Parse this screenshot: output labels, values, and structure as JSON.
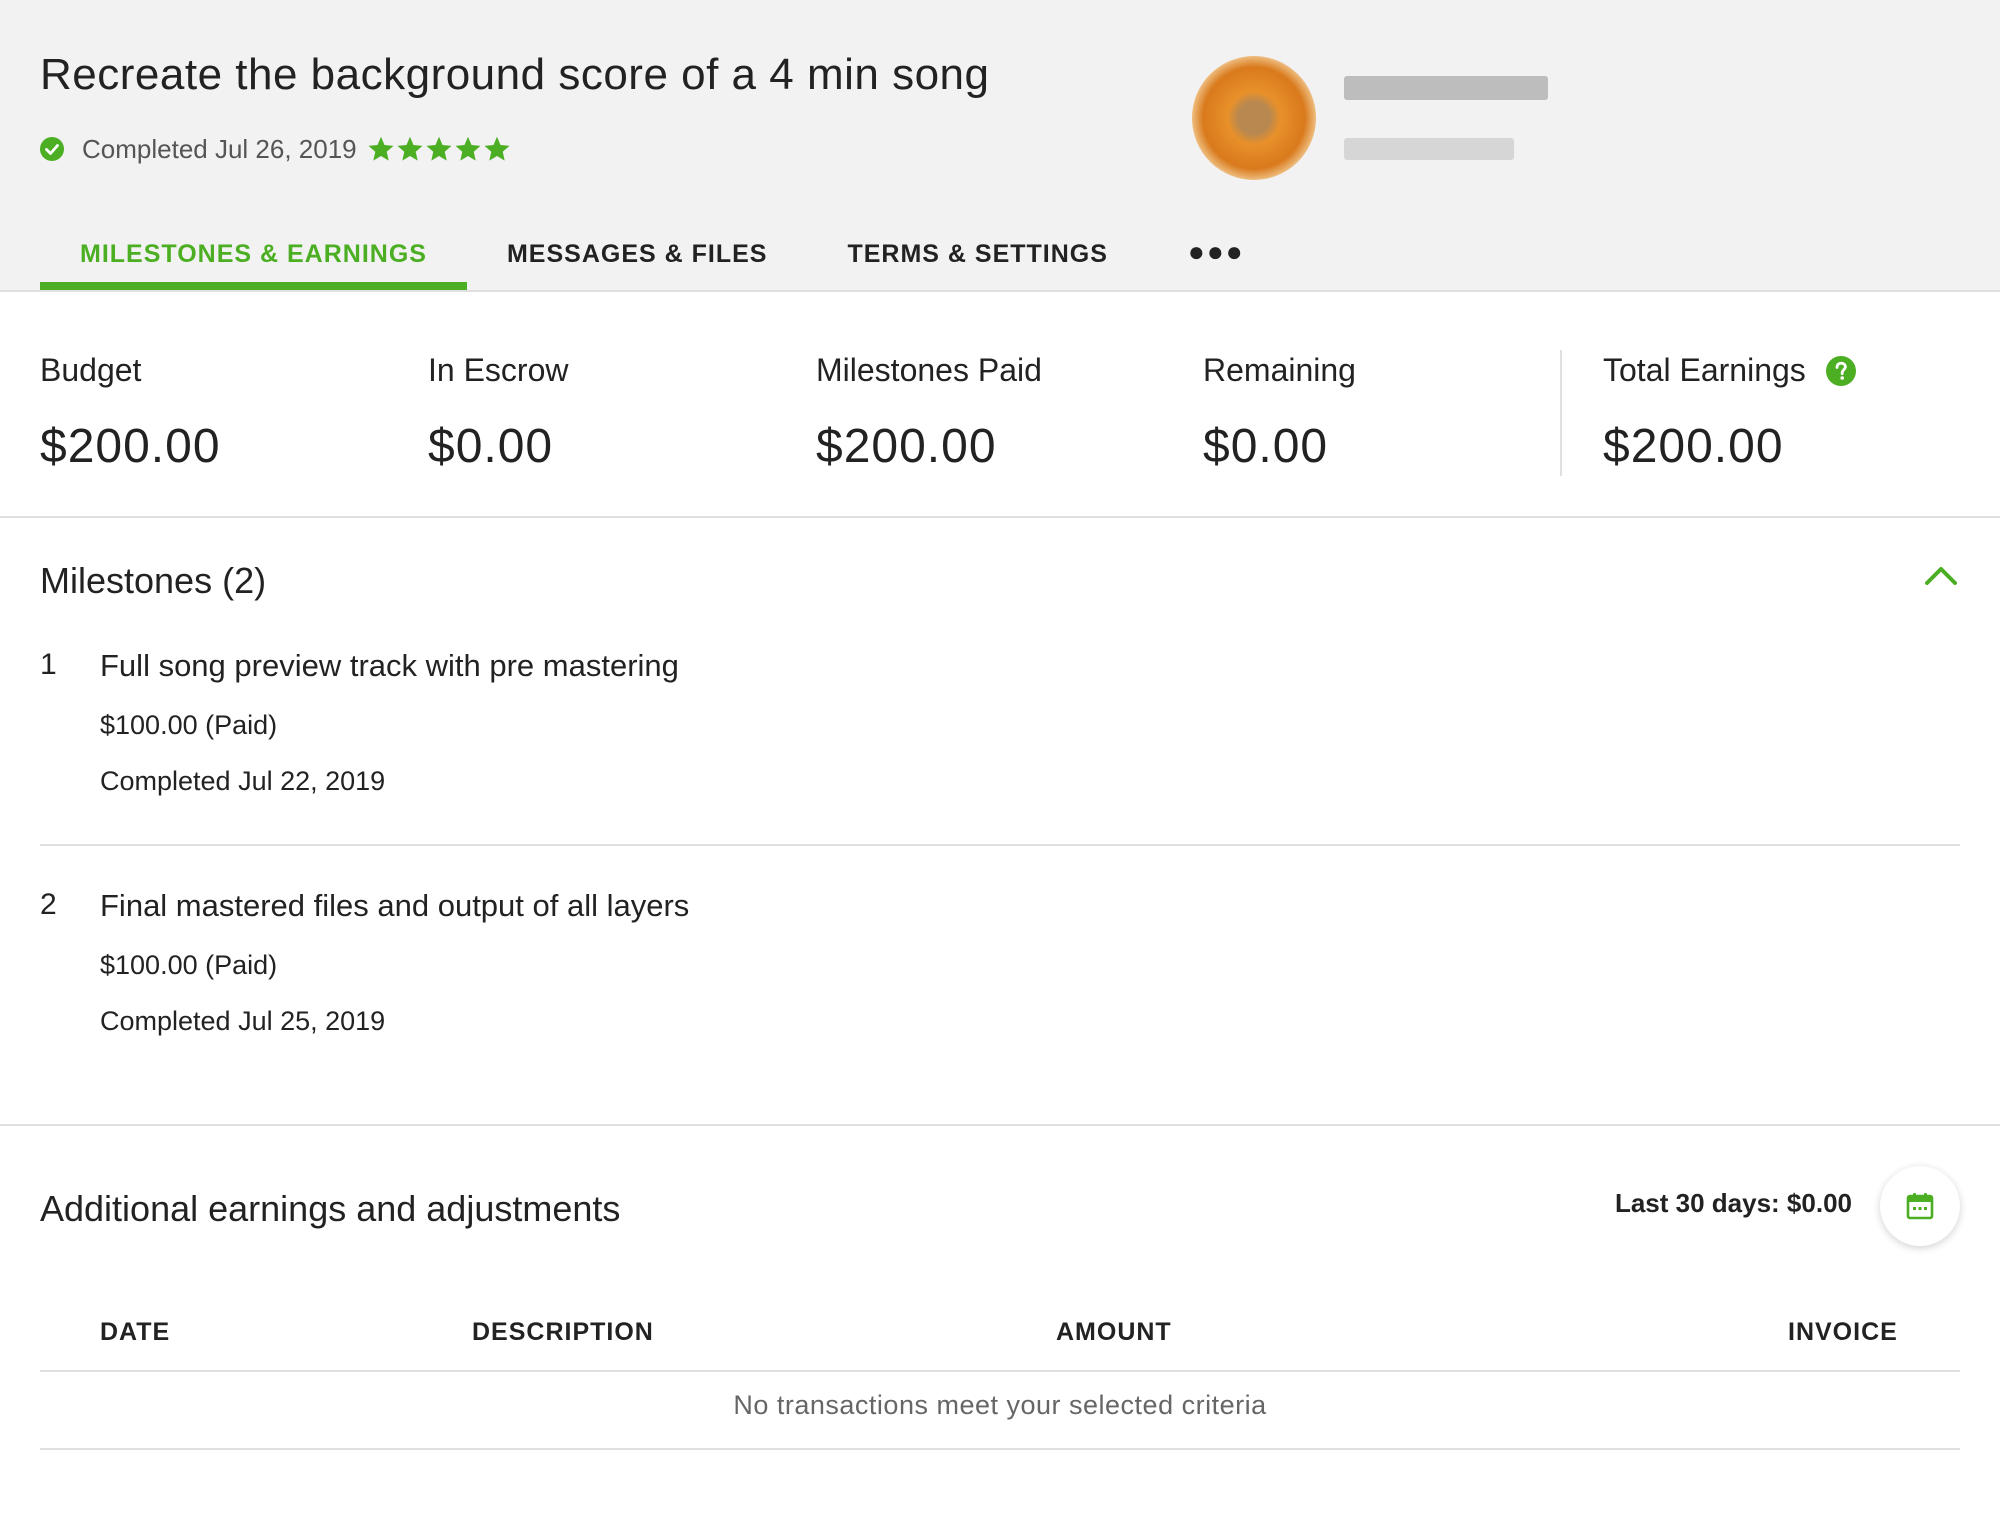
{
  "job": {
    "title": "Recreate the background score of a 4 min song",
    "status": "Completed Jul 26, 2019",
    "rating_stars": 5
  },
  "tabs": [
    {
      "label": "MILESTONES & EARNINGS",
      "active": true
    },
    {
      "label": "MESSAGES & FILES",
      "active": false
    },
    {
      "label": "TERMS & SETTINGS",
      "active": false
    }
  ],
  "tabs_more": "●●●",
  "summary": {
    "budget_label": "Budget",
    "budget_value": "$200.00",
    "escrow_label": "In Escrow",
    "escrow_value": "$0.00",
    "paid_label": "Milestones Paid",
    "paid_value": "$200.00",
    "remaining_label": "Remaining",
    "remaining_value": "$0.00",
    "total_label": "Total Earnings",
    "total_value": "$200.00"
  },
  "milestones": {
    "title": "Milestones (2)",
    "items": [
      {
        "num": "1",
        "title": "Full song preview track with pre mastering",
        "amount": "$100.00 (Paid)",
        "date": "Completed Jul 22, 2019"
      },
      {
        "num": "2",
        "title": "Final mastered files and output of all layers",
        "amount": "$100.00 (Paid)",
        "date": "Completed Jul 25, 2019"
      }
    ]
  },
  "adjustments": {
    "title": "Additional earnings and adjustments",
    "last30": "Last 30 days: $0.00",
    "columns": {
      "date": "DATE",
      "description": "DESCRIPTION",
      "amount": "AMOUNT",
      "invoice": "INVOICE"
    },
    "empty_message": "No transactions meet your selected criteria"
  },
  "colors": {
    "accent": "#4caf23",
    "text": "#222222",
    "divider": "#e0e0e0",
    "header_bg": "#f2f2f2"
  },
  "icons": {
    "status": "check-circle-icon",
    "rating": "star-icon",
    "help": "question-circle-icon",
    "collapse": "chevron-up-icon",
    "date_filter": "calendar-icon"
  }
}
